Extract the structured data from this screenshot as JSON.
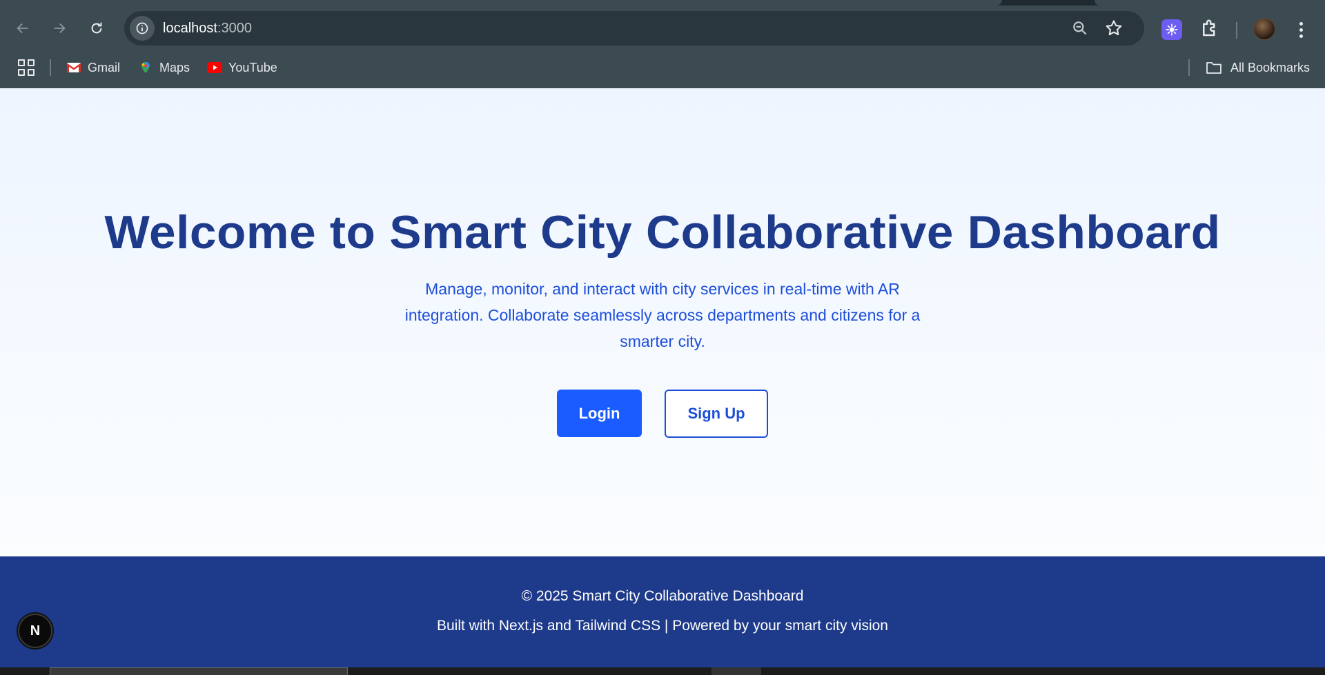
{
  "browser": {
    "url_host": "localhost",
    "url_port": ":3000",
    "bookmarks": [
      {
        "label": "Gmail",
        "icon": "gmail-icon"
      },
      {
        "label": "Maps",
        "icon": "maps-icon"
      },
      {
        "label": "YouTube",
        "icon": "youtube-icon"
      }
    ],
    "all_bookmarks_label": "All Bookmarks"
  },
  "hero": {
    "title": "Welcome to Smart City Collaborative Dashboard",
    "subtitle": "Manage, monitor, and interact with city services in real-time with AR integration. Collaborate seamlessly across departments and citizens for a smarter city.",
    "login_label": "Login",
    "signup_label": "Sign Up"
  },
  "footer": {
    "copyright": "© 2025 Smart City Collaborative Dashboard",
    "credits": "Built with Next.js and Tailwind CSS | Powered by your smart city vision"
  },
  "next_badge": {
    "letter": "N"
  },
  "colors": {
    "primary": "#1a5cff",
    "title": "#1e3a8a",
    "subtitle": "#1d4ed8",
    "footer_bg": "#1e3a8a",
    "chrome_bg": "#3c4a52"
  }
}
